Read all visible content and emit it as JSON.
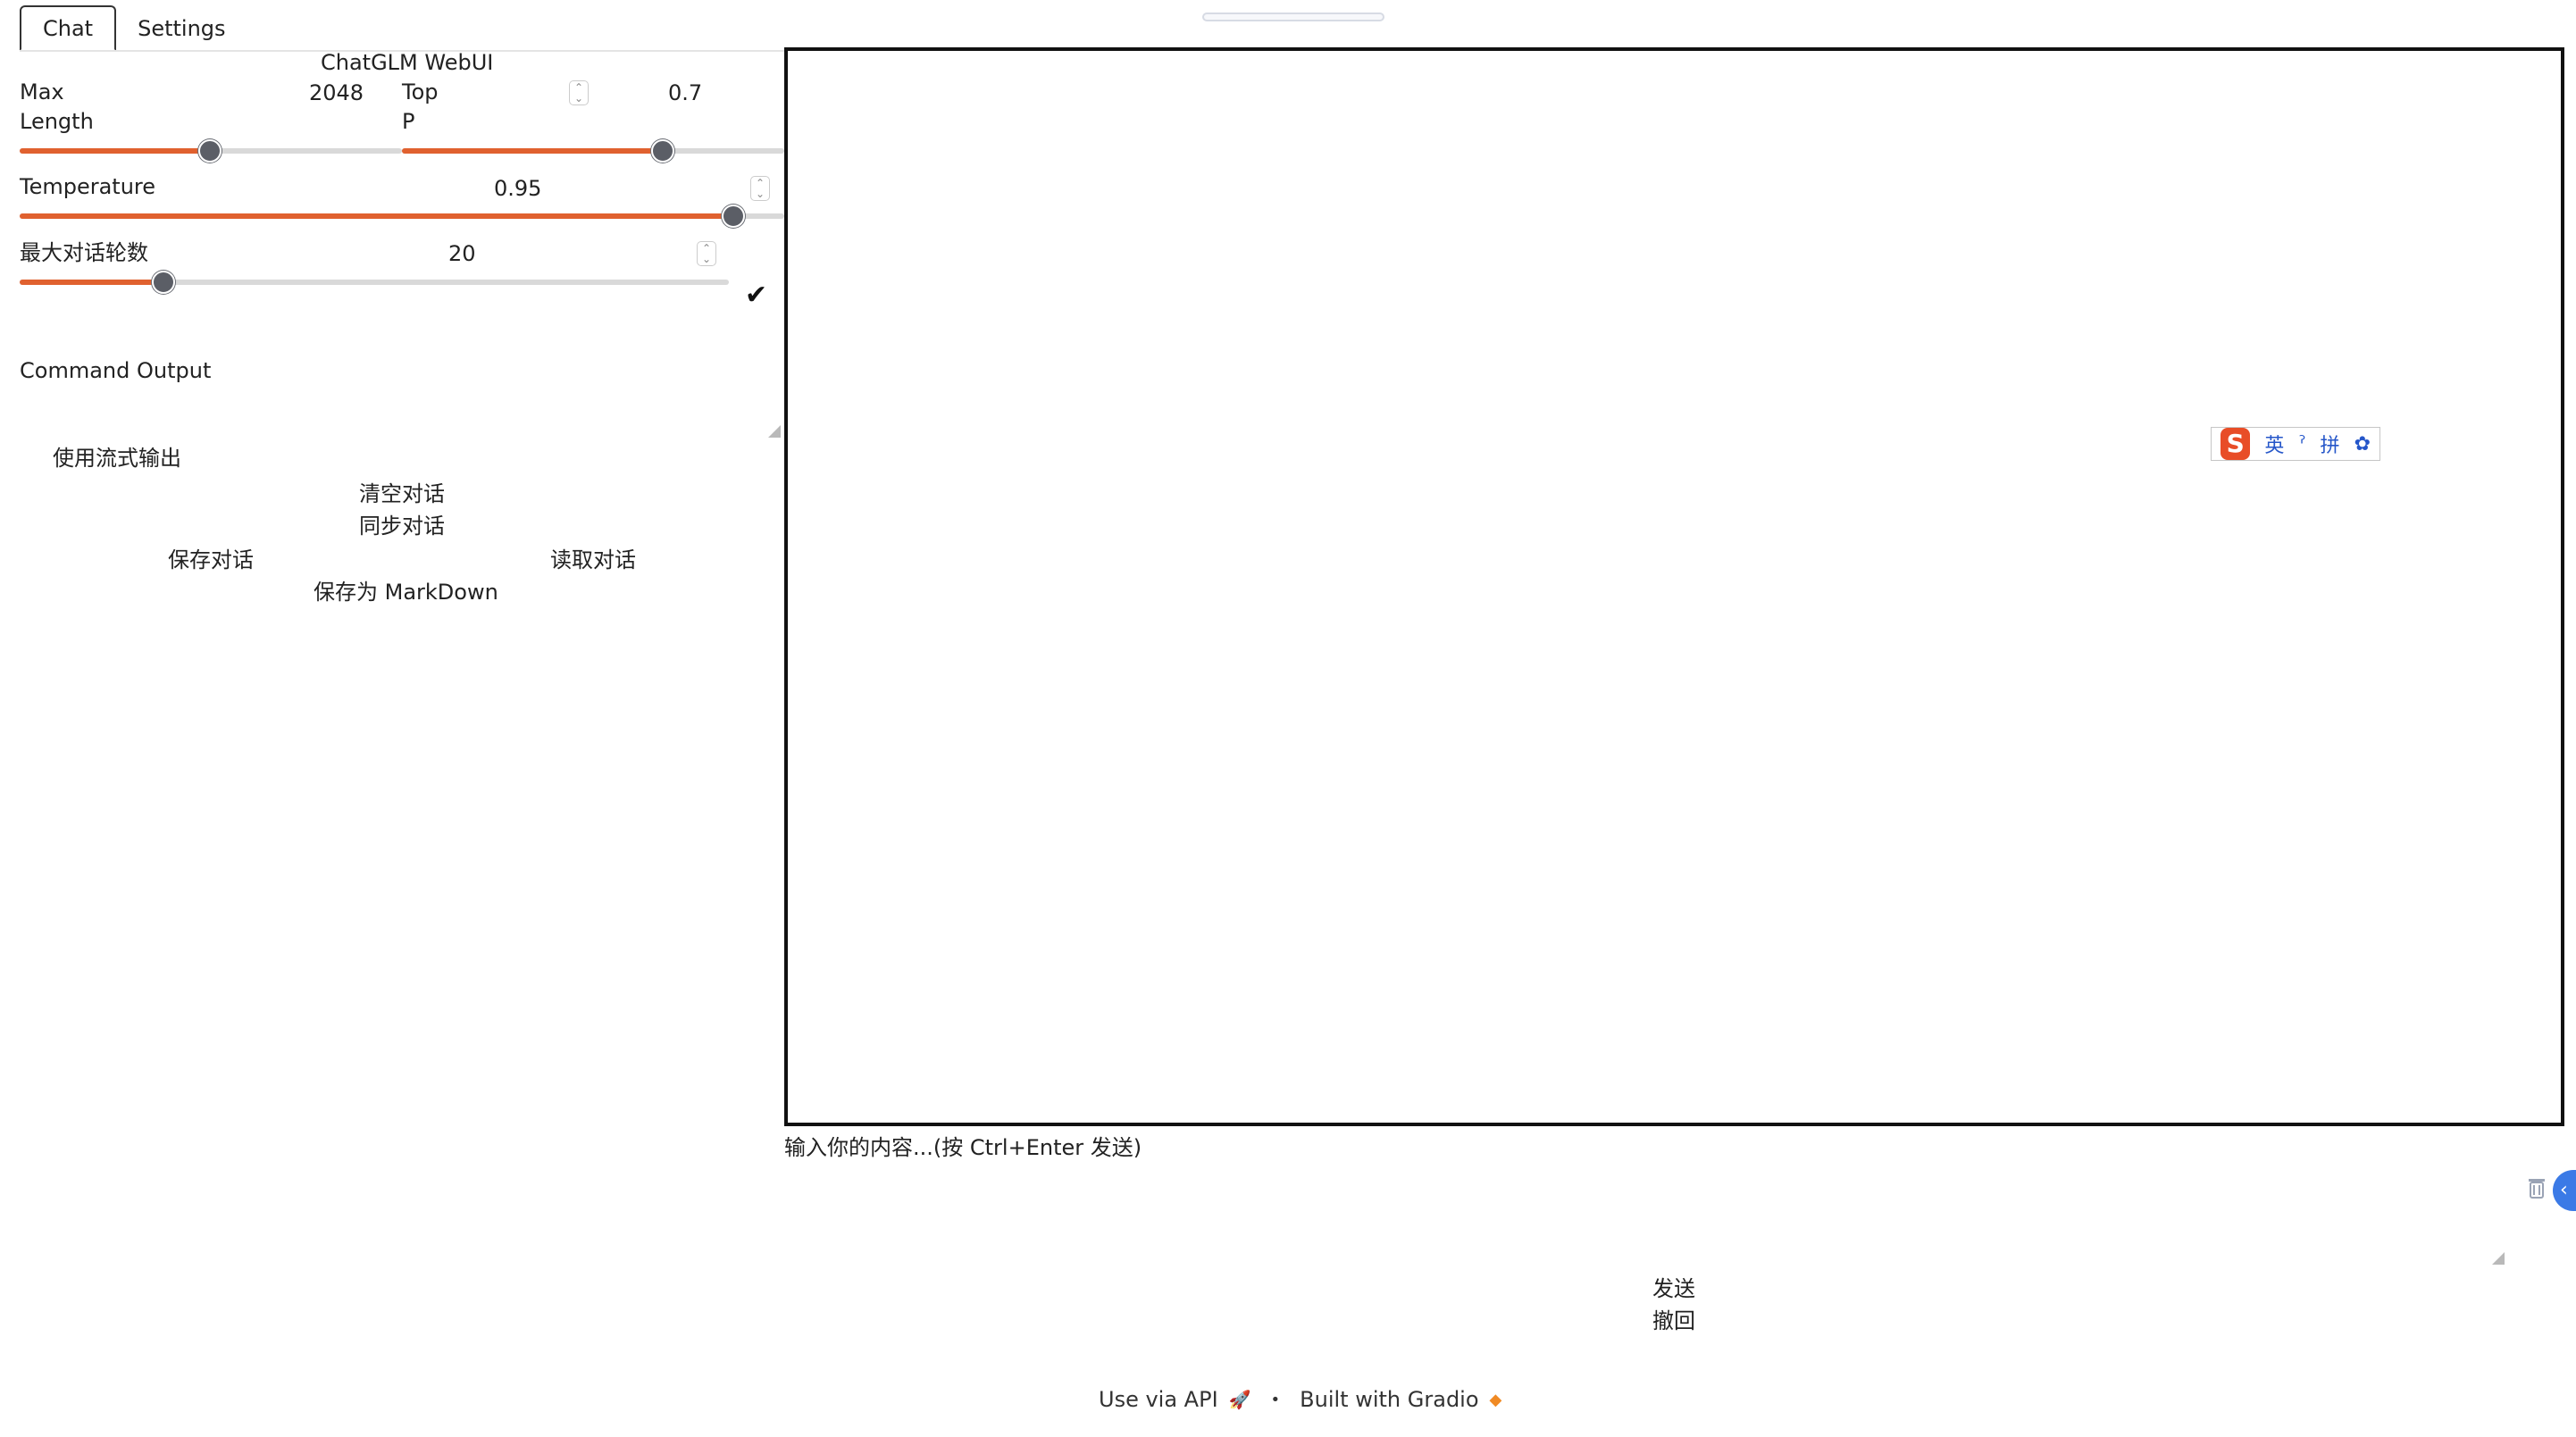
{
  "tabs": [
    {
      "label": "Chat",
      "active": true
    },
    {
      "label": "Settings",
      "active": false
    }
  ],
  "app": {
    "title": "ChatGLM WebUI"
  },
  "sliders": {
    "max_length": {
      "label_line1": "Max",
      "label_line2": "Length",
      "value": "2048",
      "min": 0,
      "max": 4096,
      "current": 2048
    },
    "top_p": {
      "label_line1": "Top",
      "label_line2": "P",
      "value": "0.7",
      "min": 0,
      "max": 1,
      "current": 0.7
    },
    "temperature": {
      "label": "Temperature",
      "value": "0.95",
      "min": 0,
      "max": 1,
      "current": 0.95
    },
    "max_rounds": {
      "label": "最大对话轮数",
      "value": "20",
      "min": 0,
      "max": 100,
      "current": 20
    }
  },
  "command_output": {
    "label": "Command Output"
  },
  "options": {
    "stream_label": "使用流式输出",
    "stream_checked": true
  },
  "buttons": {
    "clear": "清空对话",
    "sync": "同步对话",
    "save": "保存对话",
    "load": "读取对话",
    "save_markdown": "保存为 MarkDown",
    "send": "发送",
    "undo": "撤回"
  },
  "ime": {
    "lang": "英",
    "mode": "拼"
  },
  "input": {
    "placeholder": "输入你的内容...(按 Ctrl+Enter 发送)",
    "value": ""
  },
  "footer": {
    "api_label": "Use via API",
    "built_with": "Built with Gradio"
  },
  "colors": {
    "accent": "#e0612f",
    "thumb": "#5b5e66",
    "toggle": "#3b7ae6"
  },
  "icons": [
    "checkmark-icon",
    "resize-handle-icon",
    "trash-icon",
    "chevron-left-icon",
    "rocket-icon",
    "gradio-logo-icon",
    "sogou-logo-icon",
    "gear-icon"
  ]
}
